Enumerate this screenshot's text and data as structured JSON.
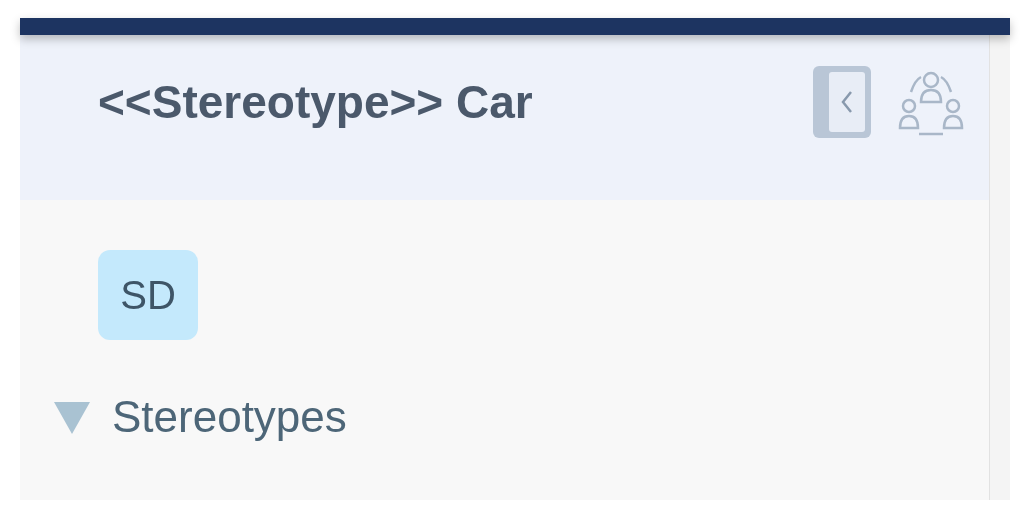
{
  "panel": {
    "title": "<<Stereotype>> Car"
  },
  "badge": {
    "text": "SD"
  },
  "tree": [
    {
      "label": "Stereotypes",
      "expanded": true
    }
  ]
}
